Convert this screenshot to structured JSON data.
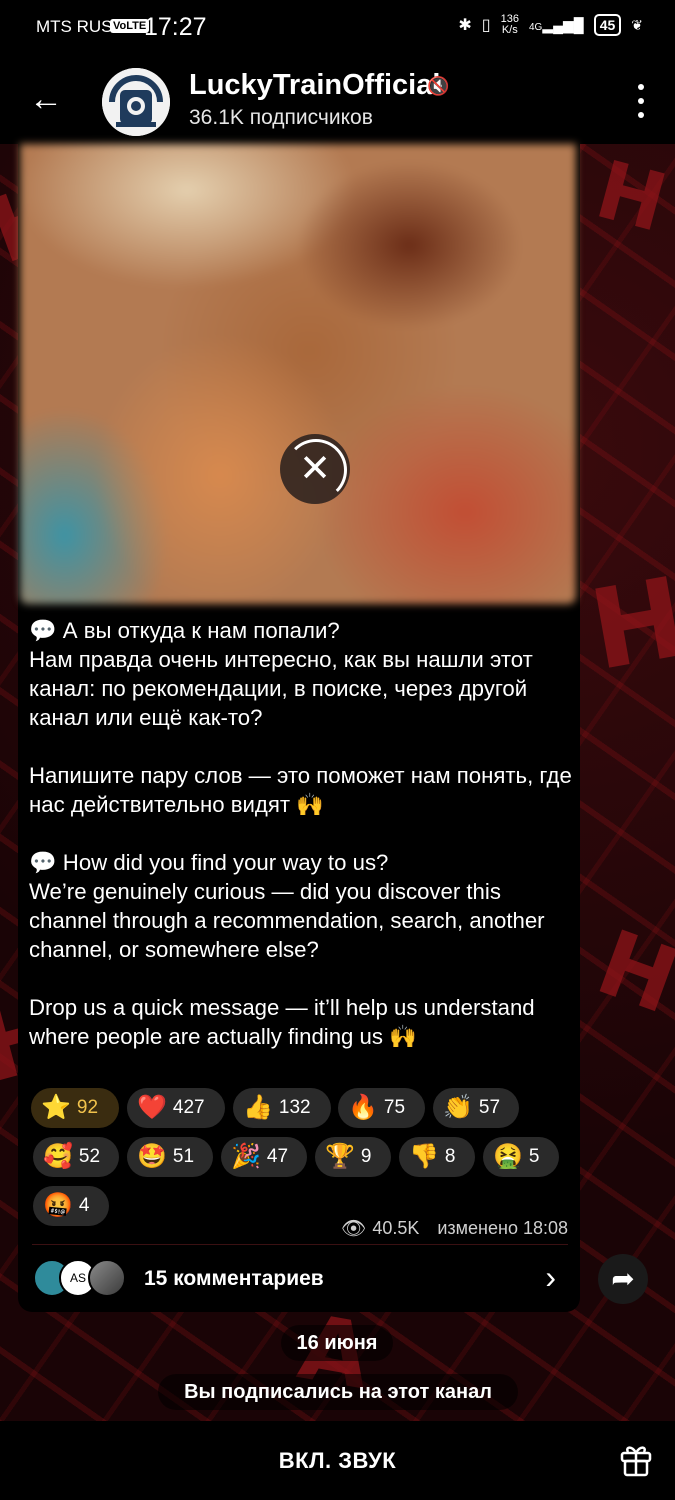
{
  "status_bar": {
    "carrier": "MTS RUS",
    "volte": "VoLTE",
    "time": "17:27",
    "net_speed_value": "136",
    "net_speed_unit": "K/s",
    "network": "4G",
    "battery": "45"
  },
  "header": {
    "title": "LuckyTrainOfficial",
    "subscribers": "36.1K подписчиков"
  },
  "message": {
    "media_state": "loading",
    "text_paragraphs": [
      "💬 А вы откуда к нам попали?\nНам правда очень интересно, как вы нашли этот канал: по рекомендации, в поиске, через другой канал или ещё как-то?",
      "Напишите пару слов — это поможет нам понять, где нас действительно видят 🙌",
      "💬 How did you find your way to us?\nWe’re genuinely curious — did you discover this channel through a recommendation, search, another channel, or somewhere else?",
      "Drop us a quick message — it’ll help us understand where people are actually finding us 🙌"
    ],
    "reactions": [
      {
        "emoji": "⭐",
        "count": "92",
        "chosen": true
      },
      {
        "emoji": "❤️",
        "count": "427"
      },
      {
        "emoji": "👍",
        "count": "132"
      },
      {
        "emoji": "🔥",
        "count": "75"
      },
      {
        "emoji": "👏",
        "count": "57"
      },
      {
        "emoji": "🥰",
        "count": "52"
      },
      {
        "emoji": "🤩",
        "count": "51"
      },
      {
        "emoji": "🎉",
        "count": "47"
      },
      {
        "emoji": "🏆",
        "count": "9"
      },
      {
        "emoji": "👎",
        "count": "8"
      },
      {
        "emoji": "🤮",
        "count": "5"
      },
      {
        "emoji": "🤬",
        "count": "4"
      }
    ],
    "views": "40.5K",
    "edited": "изменено 18:08",
    "comment_avatar_initials": "AS",
    "comments": "15 комментариев"
  },
  "date_separator": "16 июня",
  "service_message": "Вы подписались на этот канал",
  "bottom_bar": {
    "unmute_label": "ВКЛ. ЗВУК"
  }
}
